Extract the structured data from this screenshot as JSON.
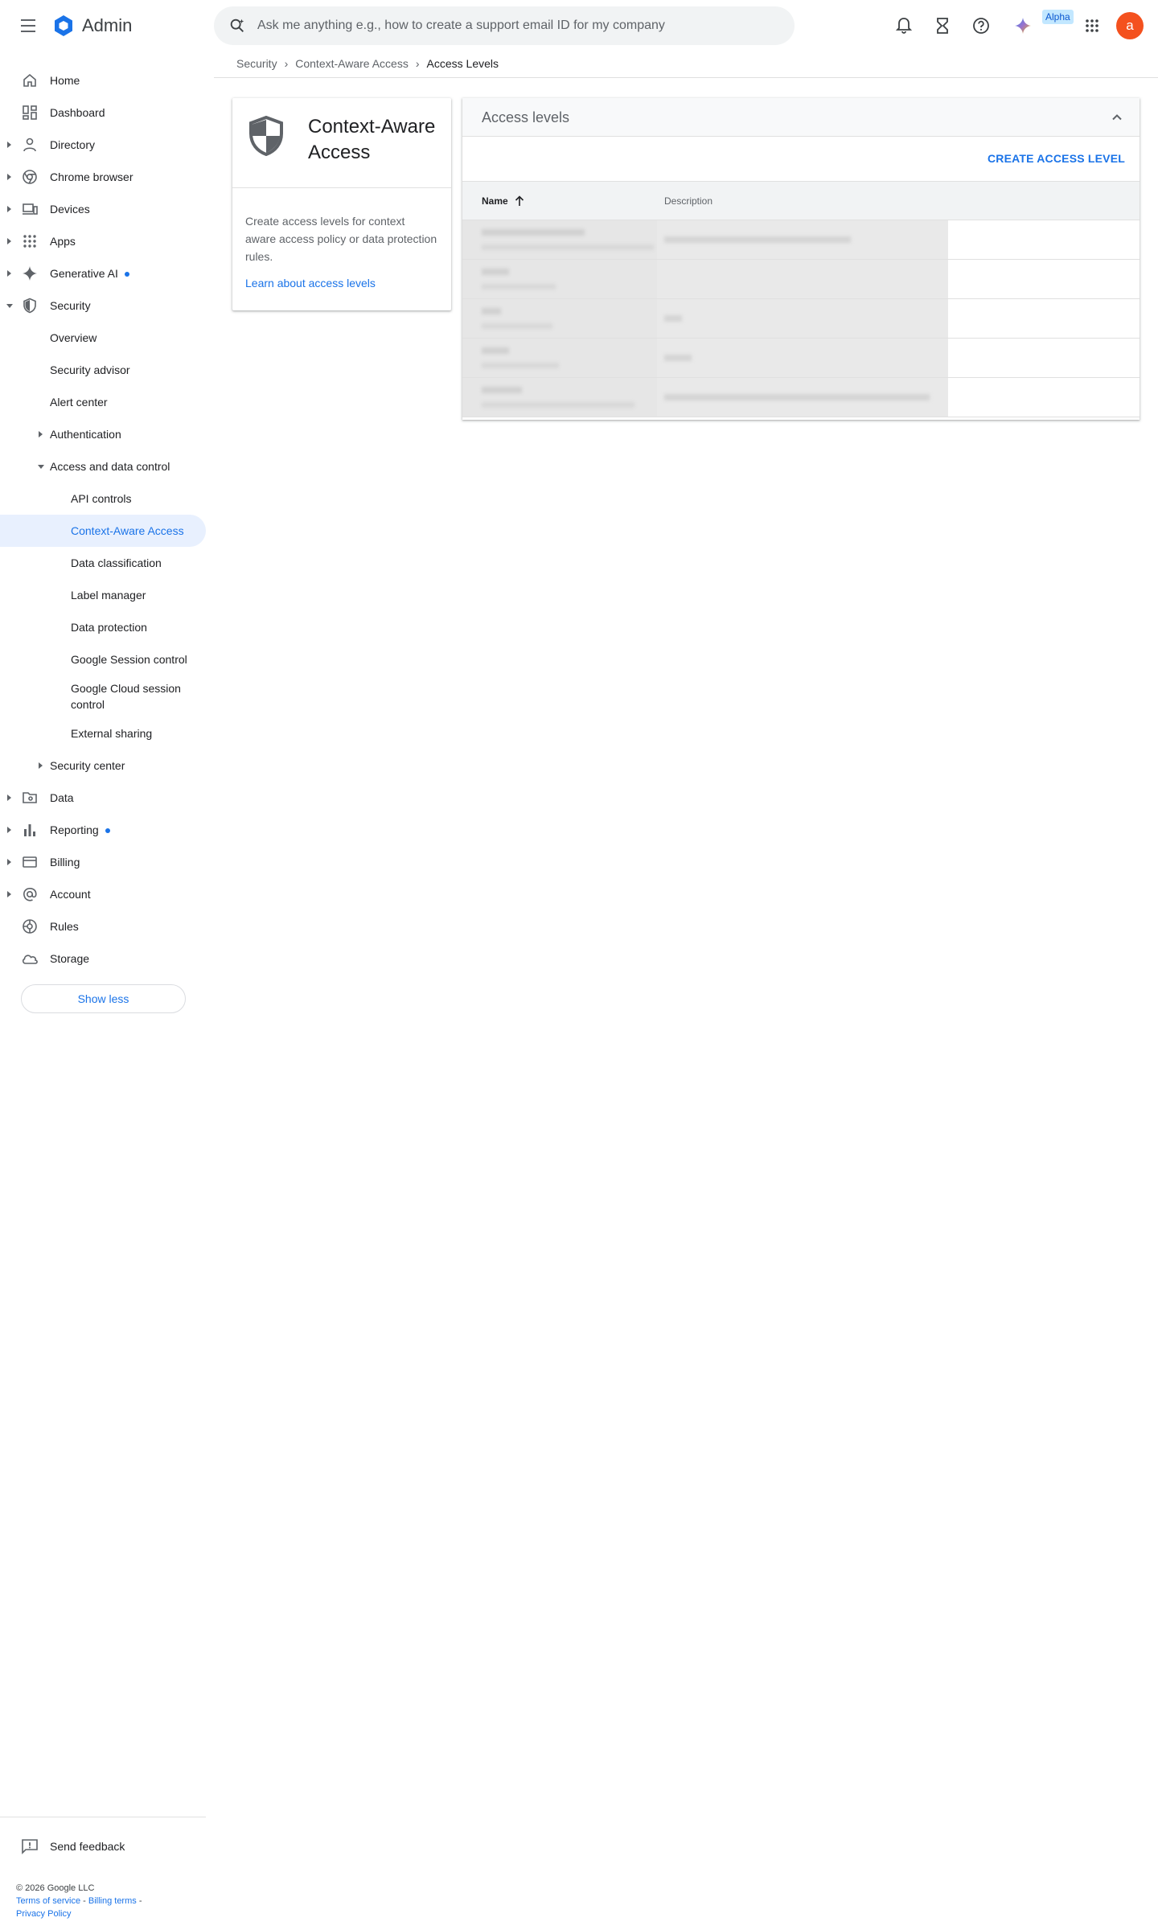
{
  "app": {
    "name": "Admin"
  },
  "search": {
    "placeholder": "Ask me anything e.g., how to create a support email ID for my company"
  },
  "header": {
    "alpha_badge": "Alpha",
    "avatar_letter": "a"
  },
  "breadcrumb": {
    "items": [
      "Security",
      "Context-Aware Access",
      "Access Levels"
    ]
  },
  "sidebar": {
    "items": [
      {
        "label": "Home"
      },
      {
        "label": "Dashboard"
      },
      {
        "label": "Directory"
      },
      {
        "label": "Chrome browser"
      },
      {
        "label": "Devices"
      },
      {
        "label": "Apps"
      },
      {
        "label": "Generative AI"
      },
      {
        "label": "Security"
      },
      {
        "label": "Overview"
      },
      {
        "label": "Security advisor"
      },
      {
        "label": "Alert center"
      },
      {
        "label": "Authentication"
      },
      {
        "label": "Access and data control"
      },
      {
        "label": "API controls"
      },
      {
        "label": "Context-Aware Access"
      },
      {
        "label": "Data classification"
      },
      {
        "label": "Label manager"
      },
      {
        "label": "Data protection"
      },
      {
        "label": "Google Session control"
      },
      {
        "label": "Google Cloud session control"
      },
      {
        "label": "External sharing"
      },
      {
        "label": "Security center"
      },
      {
        "label": "Data"
      },
      {
        "label": "Reporting"
      },
      {
        "label": "Billing"
      },
      {
        "label": "Account"
      },
      {
        "label": "Rules"
      },
      {
        "label": "Storage"
      }
    ],
    "show_less": "Show less",
    "send_feedback": "Send feedback"
  },
  "footer": {
    "copyright": "© 2026 Google LLC",
    "terms": "Terms of service",
    "billing_terms": "Billing terms",
    "privacy": "Privacy Policy"
  },
  "info_card": {
    "title": "Context-Aware Access",
    "description": "Create access levels for context aware access policy or data protection rules.",
    "link": "Learn about access levels"
  },
  "panel": {
    "title": "Access levels",
    "create_button": "CREATE ACCESS LEVEL",
    "columns": {
      "name": "Name",
      "description": "Description"
    },
    "row_count": 5
  },
  "colors": {
    "accent": "#1a73e8",
    "active_bg": "#e8f0fe",
    "avatar": "#f4511e"
  }
}
